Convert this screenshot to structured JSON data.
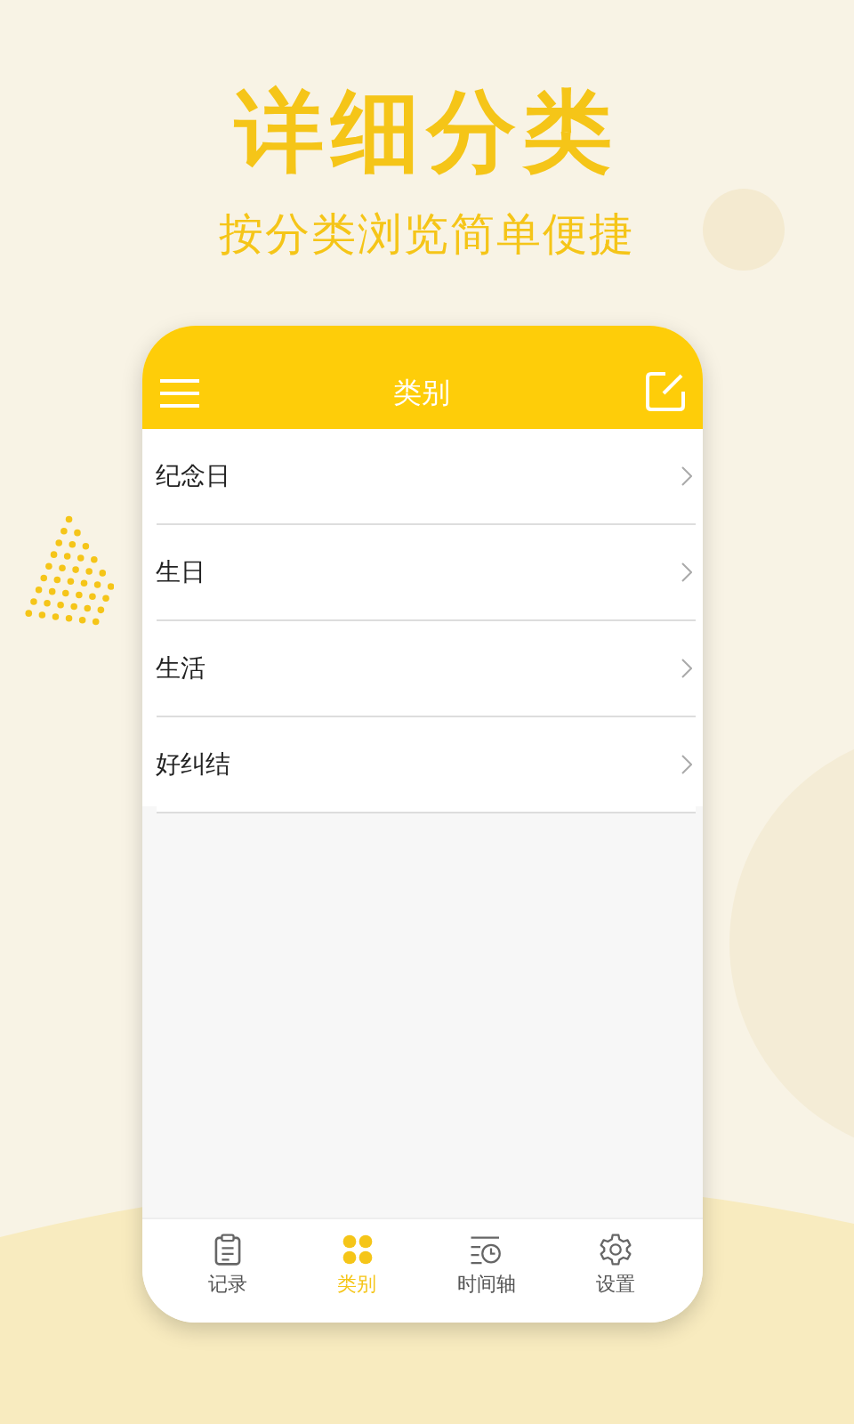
{
  "headline": "详细分类",
  "subheadline": "按分类浏览简单便捷",
  "app_bar": {
    "title": "类别"
  },
  "categories": [
    {
      "label": "纪念日"
    },
    {
      "label": "生日"
    },
    {
      "label": "生活"
    },
    {
      "label": "好纠结"
    }
  ],
  "tabs": [
    {
      "label": "记录",
      "kind": "clipboard",
      "selected": false
    },
    {
      "label": "类别",
      "kind": "clover",
      "selected": true
    },
    {
      "label": "时间轴",
      "kind": "timeline",
      "selected": false
    },
    {
      "label": "设置",
      "kind": "gear",
      "selected": false
    }
  ]
}
